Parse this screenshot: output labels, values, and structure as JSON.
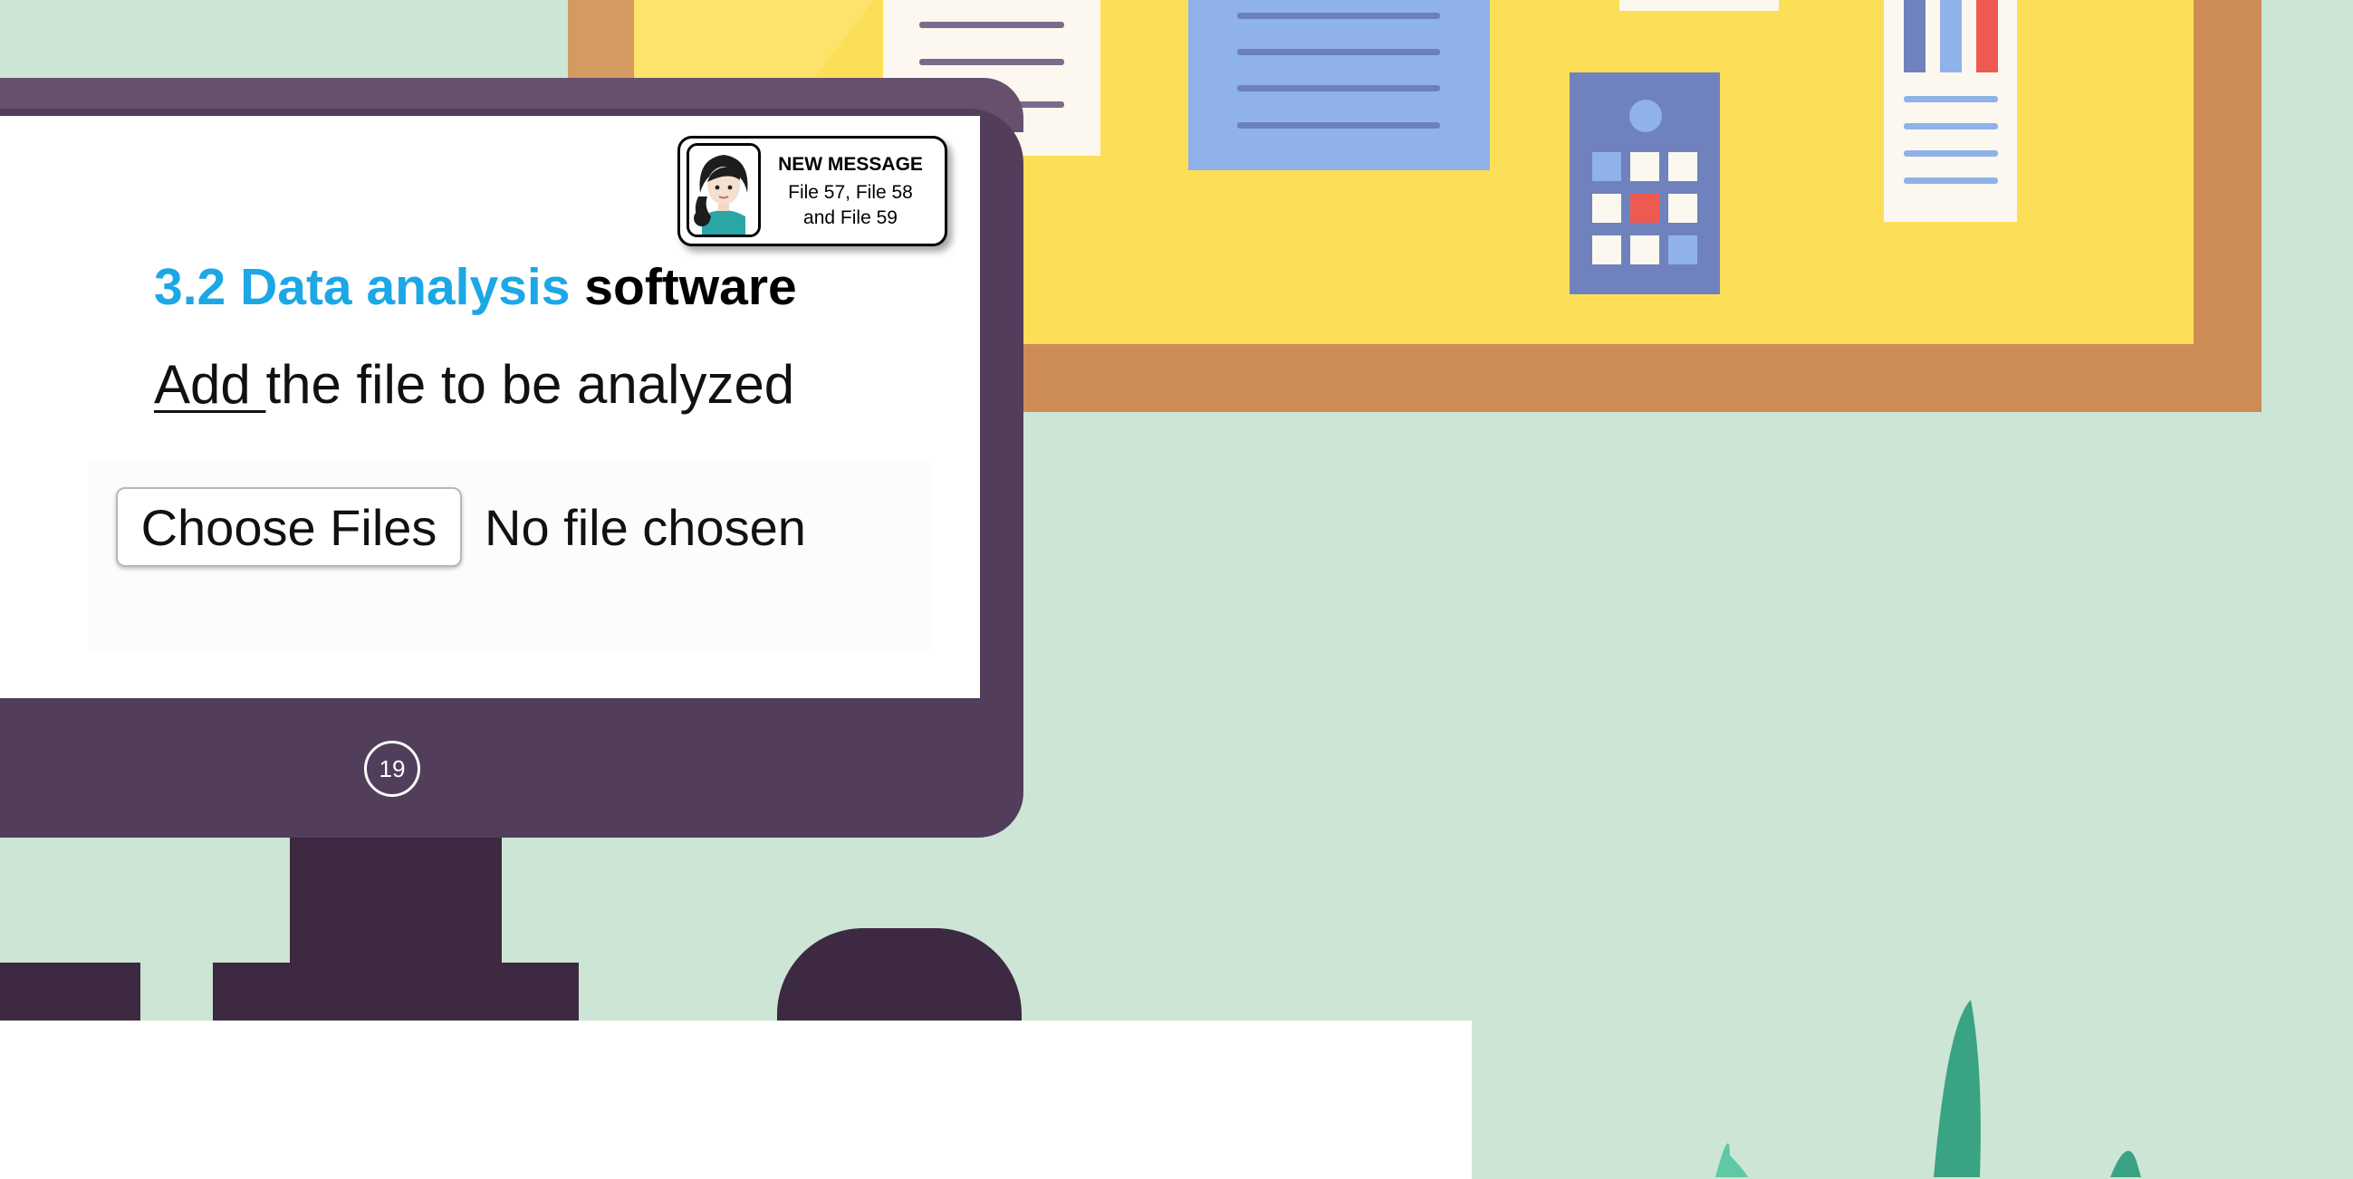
{
  "slide": {
    "heading_blue": "3.2 Data analysis",
    "heading_black": "software",
    "instruction_underlined": "Add ",
    "instruction_rest": "the file to be analyzed",
    "page_number": "19"
  },
  "file_input": {
    "button_label": "Choose Files",
    "status": "No file chosen"
  },
  "notification": {
    "title": "NEW MESSAGE",
    "line1": "File 57, File 58",
    "line2": "and File 59",
    "avatar_icon": "woman-avatar-icon"
  },
  "colors": {
    "accent_blue": "#1ca7e6",
    "background_green": "#cde5d5",
    "board_yellow": "#fddf57",
    "monitor_purple": "#523d5b"
  }
}
